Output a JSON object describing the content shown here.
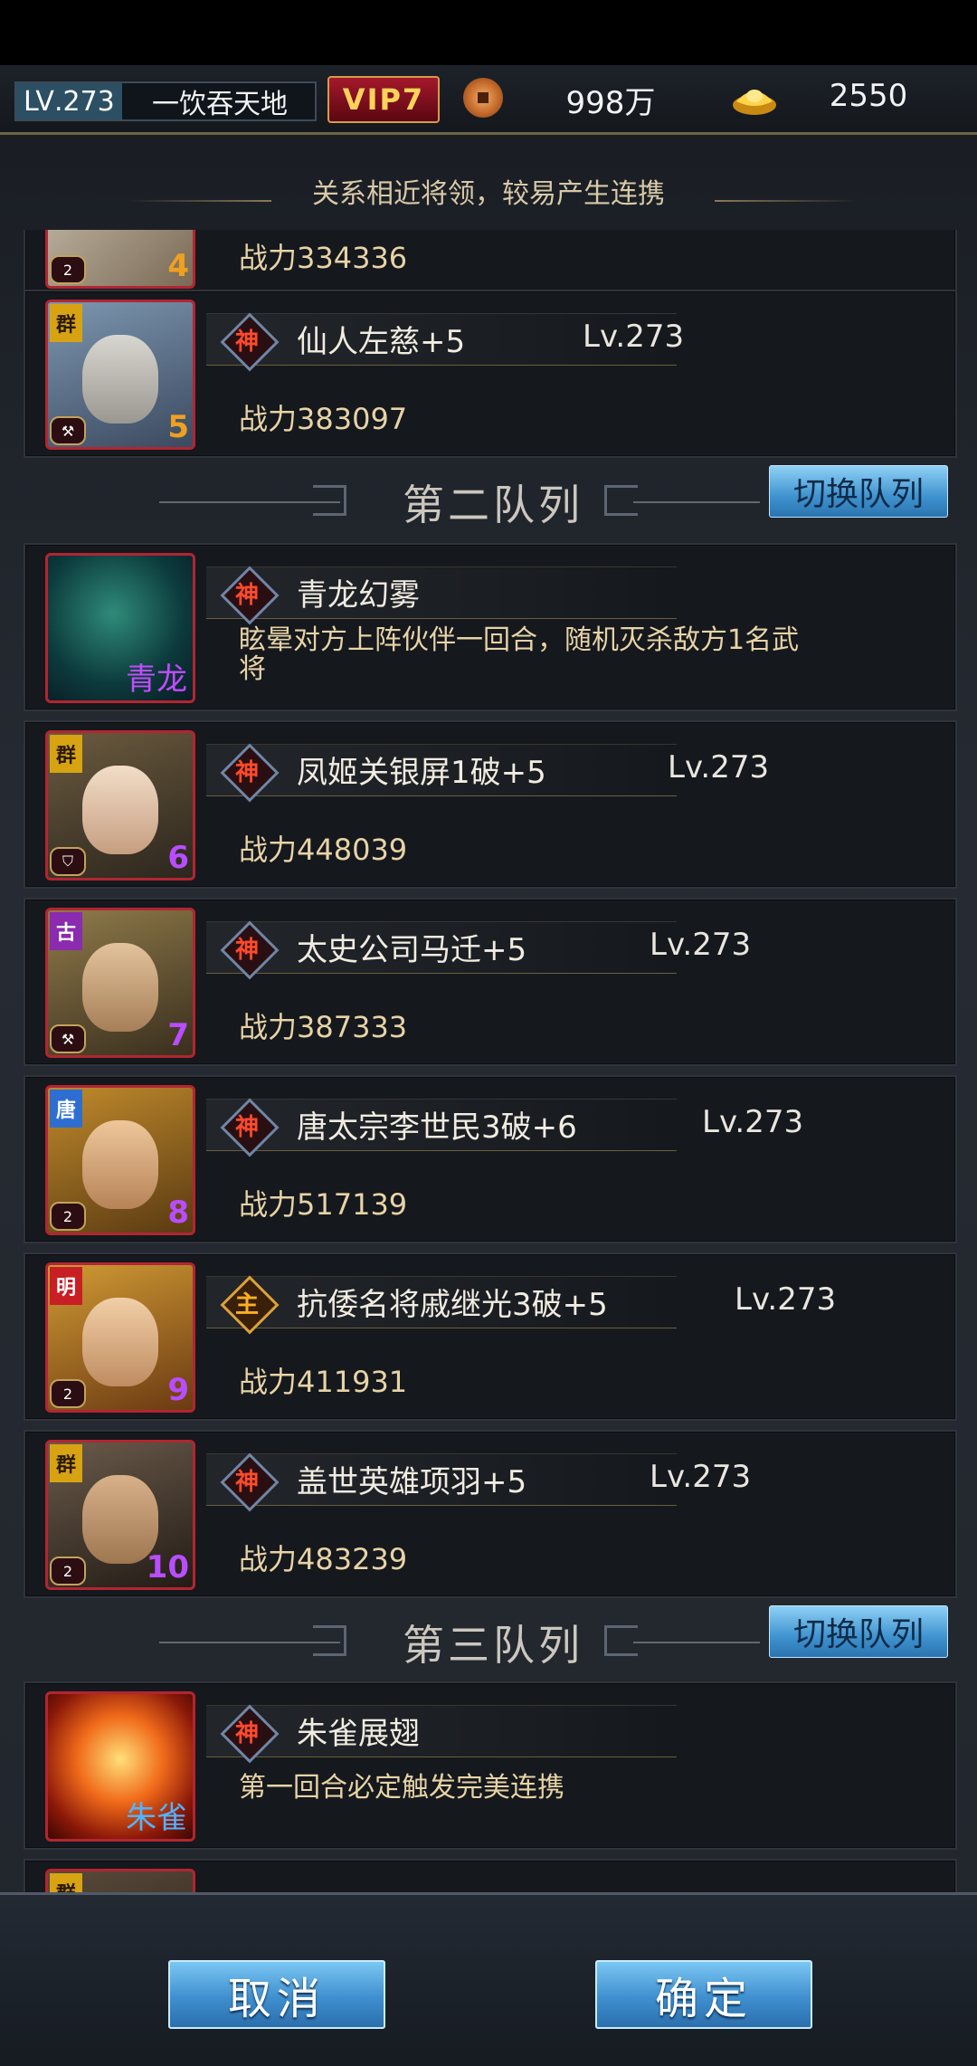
{
  "topbar": {
    "level_prefix": "LV",
    "level_value": ".273",
    "player_name": "一饮吞天地",
    "vip": "VIP7",
    "copper": "998万",
    "ingot": "2550",
    "icons": {
      "copper": "copper-coin-icon",
      "ingot": "gold-ingot-icon"
    }
  },
  "hint": "关系相近将领，较易产生连携",
  "cards_top": [
    {
      "role": "2",
      "num": "4",
      "power": "战力334336"
    },
    {
      "faction": "群",
      "role": "⚒",
      "num": "5",
      "name": "仙人左慈+5",
      "level": "Lv.273",
      "power": "战力383097"
    }
  ],
  "section2": {
    "title": "第二队列",
    "switch": "切换队列"
  },
  "section2_skill": {
    "tag": "青龙",
    "name": "青龙幻雾",
    "desc": "眩晕对方上阵伙伴一回合，随机灭杀敌方1名武将"
  },
  "section2_generals": [
    {
      "faction": "群",
      "role": "⛉",
      "num": "6",
      "mark": "神",
      "name": "凤姬关银屏1破+5",
      "level": "Lv.273",
      "power": "战力448039"
    },
    {
      "faction": "古",
      "role": "⚒",
      "num": "7",
      "mark": "神",
      "name": "太史公司马迁+5",
      "level": "Lv.273",
      "power": "战力387333"
    },
    {
      "faction": "唐",
      "role": "2",
      "num": "8",
      "mark": "神",
      "name": "唐太宗李世民3破+6",
      "level": "Lv.273",
      "power": "战力517139"
    },
    {
      "faction": "明",
      "role": "2",
      "num": "9",
      "mark": "主",
      "name": "抗倭名将戚继光3破+5",
      "level": "Lv.273",
      "power": "战力411931"
    },
    {
      "faction": "群",
      "role": "2",
      "num": "10",
      "mark": "神",
      "name": "盖世英雄项羽+5",
      "level": "Lv.273",
      "power": "战力483239"
    }
  ],
  "section3": {
    "title": "第三队列",
    "switch": "切换队列"
  },
  "section3_skill": {
    "tag": "朱雀",
    "name": "朱雀展翅",
    "desc": "第一回合必定触发完美连携"
  },
  "partial": {
    "faction": "群"
  },
  "mark_default": "神",
  "buttons": {
    "cancel": "取消",
    "confirm": "确定"
  },
  "colors": {
    "accent_blue": "#3f93cf",
    "frame_red": "#b22532",
    "gold_text": "#e7d3a6"
  }
}
